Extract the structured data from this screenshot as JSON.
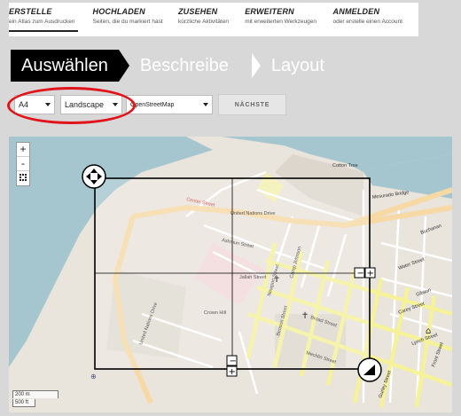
{
  "nav": [
    {
      "title": "ERSTELLE",
      "sub": "ein Atlas zum Ausdrucken"
    },
    {
      "title": "HOCHLADEN",
      "sub": "Seiten, die du markiert hast"
    },
    {
      "title": "ZUSEHEN",
      "sub": "kürzliche Aktivitäten"
    },
    {
      "title": "ERWEITERN",
      "sub": "mit erweiterten Werkzeugen"
    },
    {
      "title": "ANMELDEN",
      "sub": "oder erstelle einen Account"
    }
  ],
  "steps": {
    "active": "Auswählen",
    "second": "Beschreibe",
    "third": "Layout"
  },
  "controls": {
    "paper": "A4",
    "orientation": "Landscape",
    "provider": "OpenStreetMap",
    "next": "NÄCHSTE"
  },
  "map": {
    "zoom_in": "+",
    "zoom_out": "-",
    "scale_m": "200 m",
    "scale_ft": "500 ft",
    "labels": {
      "united_nations_drive": "United Nations Drive",
      "ashmun_street": "Ashmun Street",
      "broad_street": "Broad Street",
      "benson_street": "Benson Street",
      "mechlin_street": "Mechlin Street",
      "newport_street": "Newport Street",
      "water_street": "Water Street",
      "carey_street": "Carey Street",
      "gurley_street": "Gurley Street",
      "lynch_street": "Lynch Street",
      "un_drive_v": "United Nations Drive",
      "mesurado_bridge": "Mesurado Bridge",
      "center_st": "Center Street",
      "camp_johnson": "Camp Johnson",
      "buchanan": "Buchanan",
      "gibson": "Gibson",
      "jallah_st": "Jallah Street",
      "crown_hill": "Crown Hill",
      "front_st": "Front Street",
      "cottontree": "Cotton Tree"
    },
    "colors": {
      "sea": "#a5c6ce",
      "land": "#e9e4dc",
      "major_road": "#f7d9a6",
      "secondary_road": "#f5f29a",
      "frame": "#000000"
    }
  }
}
